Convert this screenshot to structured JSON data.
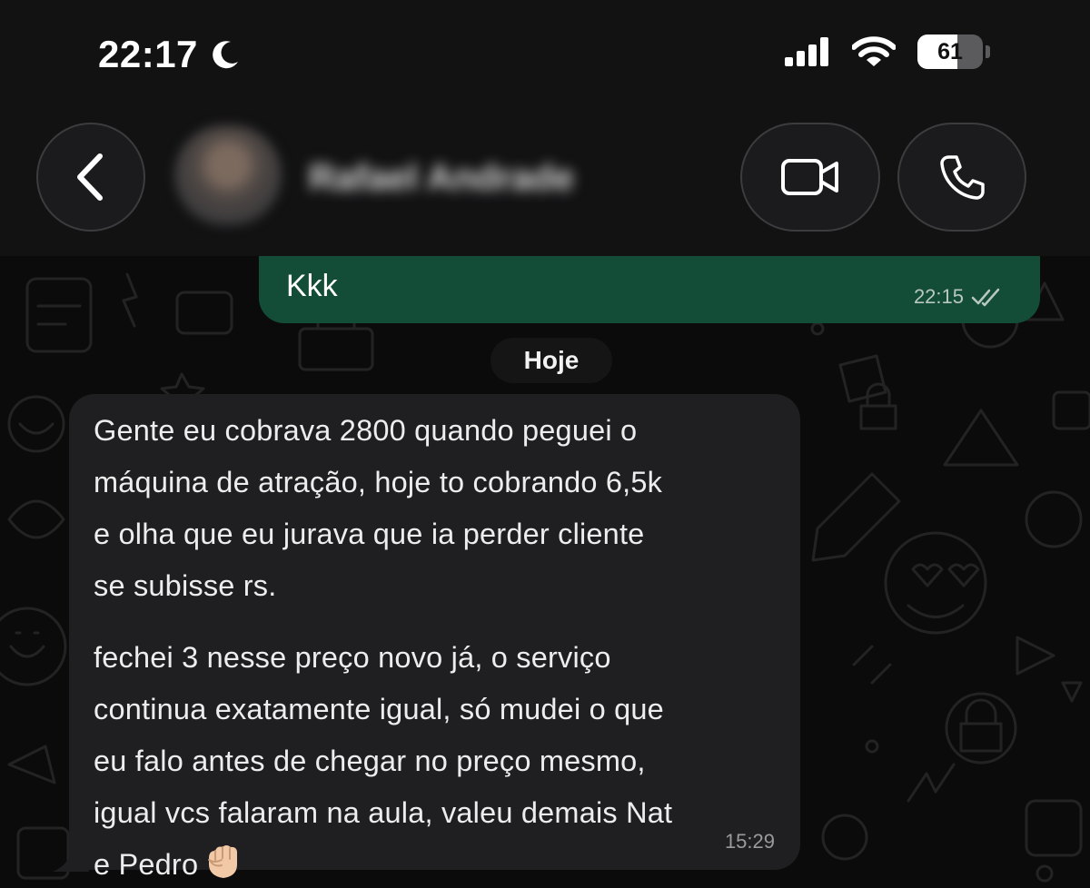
{
  "status_bar": {
    "time": "22:17",
    "battery_level": "61",
    "battery_fraction": 0.61,
    "icons": [
      "moon-icon",
      "signal-icon",
      "wifi-icon",
      "battery-icon"
    ]
  },
  "header": {
    "contact_name": "Rafael Andrade",
    "icons": [
      "chevron-left-icon",
      "video-camera-icon",
      "phone-icon"
    ]
  },
  "chat": {
    "outgoing_message": {
      "text": "Kkk",
      "time": "22:15",
      "status_icon": "double-check-icon"
    },
    "date_separator": "Hoje",
    "incoming_message": {
      "paragraph_1": "Gente eu cobrava 2800 quando peguei o\nmáquina de atração, hoje to cobrando 6,5k\ne olha que eu jurava que ia perder cliente\nse subisse rs.",
      "paragraph_2": "fechei 3 nesse preço novo já, o serviço\ncontinua exatamente igual, só mudei o que\neu falo antes de chegar no preço mesmo,\nigual vcs falaram na aula, valeu demais Nat\ne Pedro",
      "emoji": "fist-emoji",
      "time": "15:29"
    }
  },
  "colors": {
    "outgoing_bubble": "#134d37",
    "incoming_bubble": "#1f1f21",
    "background": "#0b0b0b"
  }
}
